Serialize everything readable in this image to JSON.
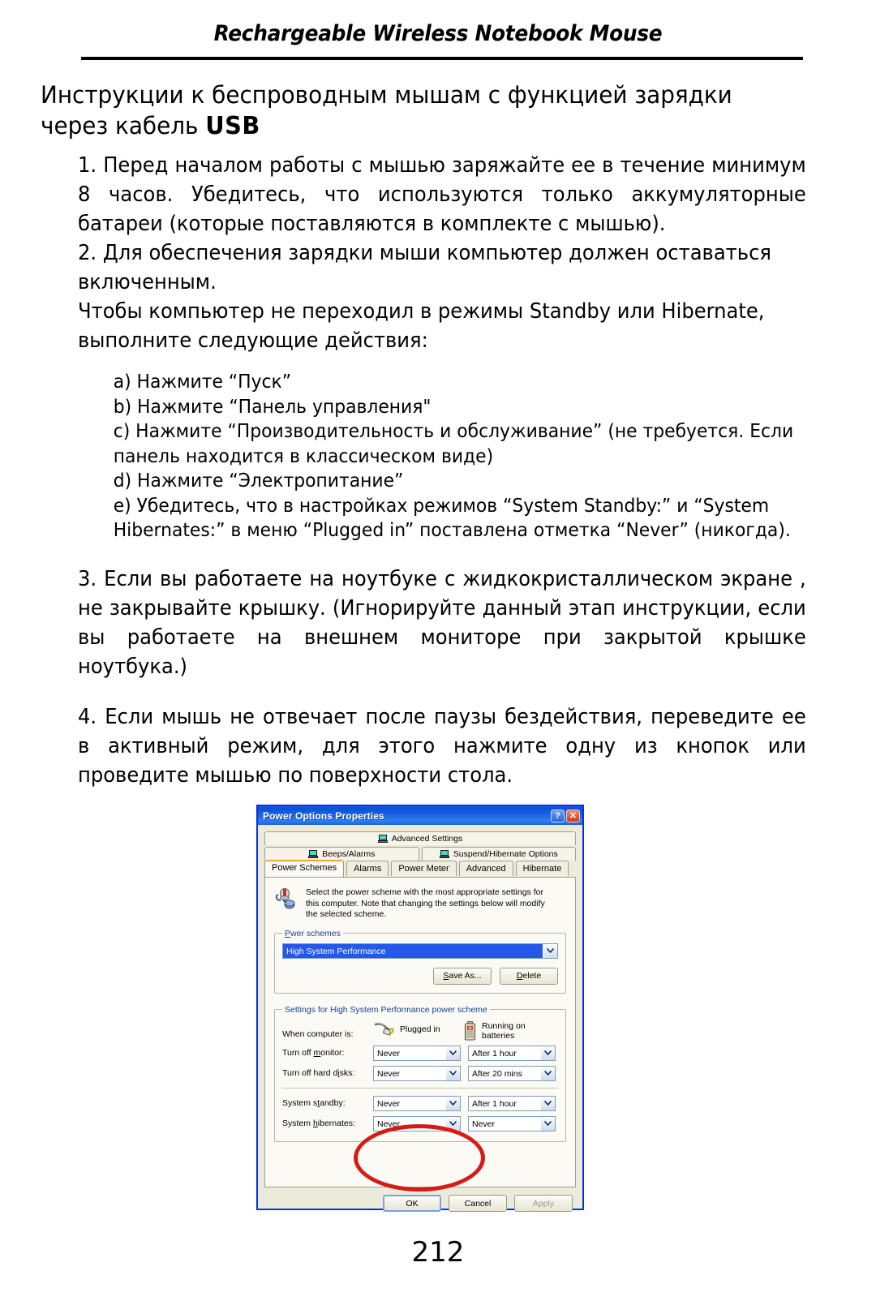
{
  "header": {
    "running_title": "Rechargeable Wireless Notebook Mouse"
  },
  "title": {
    "line1": "Инструкции к беспроводным мышам с функцией зарядки",
    "line2_prefix": "через кабель ",
    "line2_strong": "USB"
  },
  "body": {
    "p1": "1. Перед началом работы с мышью заряжайте ее в течение минимум 8 часов. Убедитесь, что используются только аккумуляторные батареи (которые поставляются в комплекте с мышью).",
    "p2": "2. Для обеспечения зарядки мыши компьютер должен оставаться включенным.",
    "p3": "Чтобы компьютер не переходил в режимы Standby или Hibernate, выполните следующие действия:",
    "sub_items": [
      "a) Нажмите “Пуск”",
      "b) Нажмите “Панель управления\"",
      "c) Нажмите “Производительность и обслуживание” (не требуется. Если панель находится в классическом виде)",
      "d) Нажмите “Электропитание”",
      "e) Убедитесь, что в настройках режимов “System Standby:” и “System Hibernates:” в меню “Plugged in” поставлена отметка “Never” (никогда)."
    ],
    "p4": "3. Если вы работаете на ноутбуке с жидкокристаллическом экране , не закрывайте крышку. (Игнорируйте данный этап инструкции, если вы работаете на внешнем мониторе при закрытой крышке ноутбука.)",
    "p5": "4. Если мышь не отвечает после паузы бездействия, переведите ее в активный режим, для этого нажмите одну из кнопок или проведите мышью по поверхности стола."
  },
  "dialog": {
    "title": "Power Options Properties",
    "help_button": "?",
    "close_button": "✕",
    "upper_tabs": [
      {
        "label": "Advanced Settings"
      }
    ],
    "mid_tabs": [
      {
        "label": "Beeps/Alarms"
      },
      {
        "label": "Suspend/Hibernate Options"
      }
    ],
    "tabs": [
      {
        "label": "Power Schemes",
        "active": true
      },
      {
        "label": "Alarms",
        "active": false
      },
      {
        "label": "Power Meter",
        "active": false
      },
      {
        "label": "Advanced",
        "active": false
      },
      {
        "label": "Hibernate",
        "active": false
      }
    ],
    "description": "Select the power scheme with the most appropriate settings for this computer. Note that changing the settings below will modify the selected scheme.",
    "power_schemes": {
      "legend_pre": "P",
      "legend_underline": "o",
      "legend_post": "wer schemes",
      "legend": "Power schemes",
      "selected_scheme": "High System Performance",
      "save_as_label": "Save As...",
      "save_as_accel": "S",
      "delete_label": "Delete",
      "delete_accel": "D"
    },
    "settings_group": {
      "legend": "Settings for High System  Performance power scheme",
      "when_label": "When computer is:",
      "plugged_in_label": "Plugged in",
      "batteries_label_line1": "Running on",
      "batteries_label_line2": "batteries",
      "rows": [
        {
          "label_pre": "Turn off ",
          "label_accel": "m",
          "label_post": "onitor:",
          "label": "Turn off monitor:",
          "plugged": "Never",
          "battery": "After 1 hour"
        },
        {
          "label_pre": "Turn off hard d",
          "label_accel": "i",
          "label_post": "sks:",
          "label": "Turn off hard disks:",
          "plugged": "Never",
          "battery": "After 20 mins"
        },
        {
          "label_pre": "System s",
          "label_accel": "t",
          "label_post": "andby:",
          "label": "System standby:",
          "plugged": "Never",
          "battery": "After 1 hour"
        },
        {
          "label_pre": "System ",
          "label_accel": "h",
          "label_post": "ibernates:",
          "label": "System hibernates:",
          "plugged": "Never",
          "battery": "Never"
        }
      ]
    },
    "footer_buttons": [
      {
        "label": "OK",
        "state": "default"
      },
      {
        "label": "Cancel",
        "state": "normal"
      },
      {
        "label": "Apply",
        "state": "disabled"
      }
    ],
    "annotation": {
      "type": "red-ellipse-highlight",
      "color": "#d61a15",
      "targets": [
        "System standby plugged-in dropdown",
        "System hibernates plugged-in dropdown"
      ]
    }
  },
  "page_number": "212",
  "colors": {
    "titlebar_blue": "#0a4fd6",
    "selection_blue": "#2458e8",
    "dialog_face": "#eceadb",
    "tab_pane": "#fbfaf5",
    "accent_orange": "#f0a72a",
    "annotation_red": "#d61a15"
  }
}
